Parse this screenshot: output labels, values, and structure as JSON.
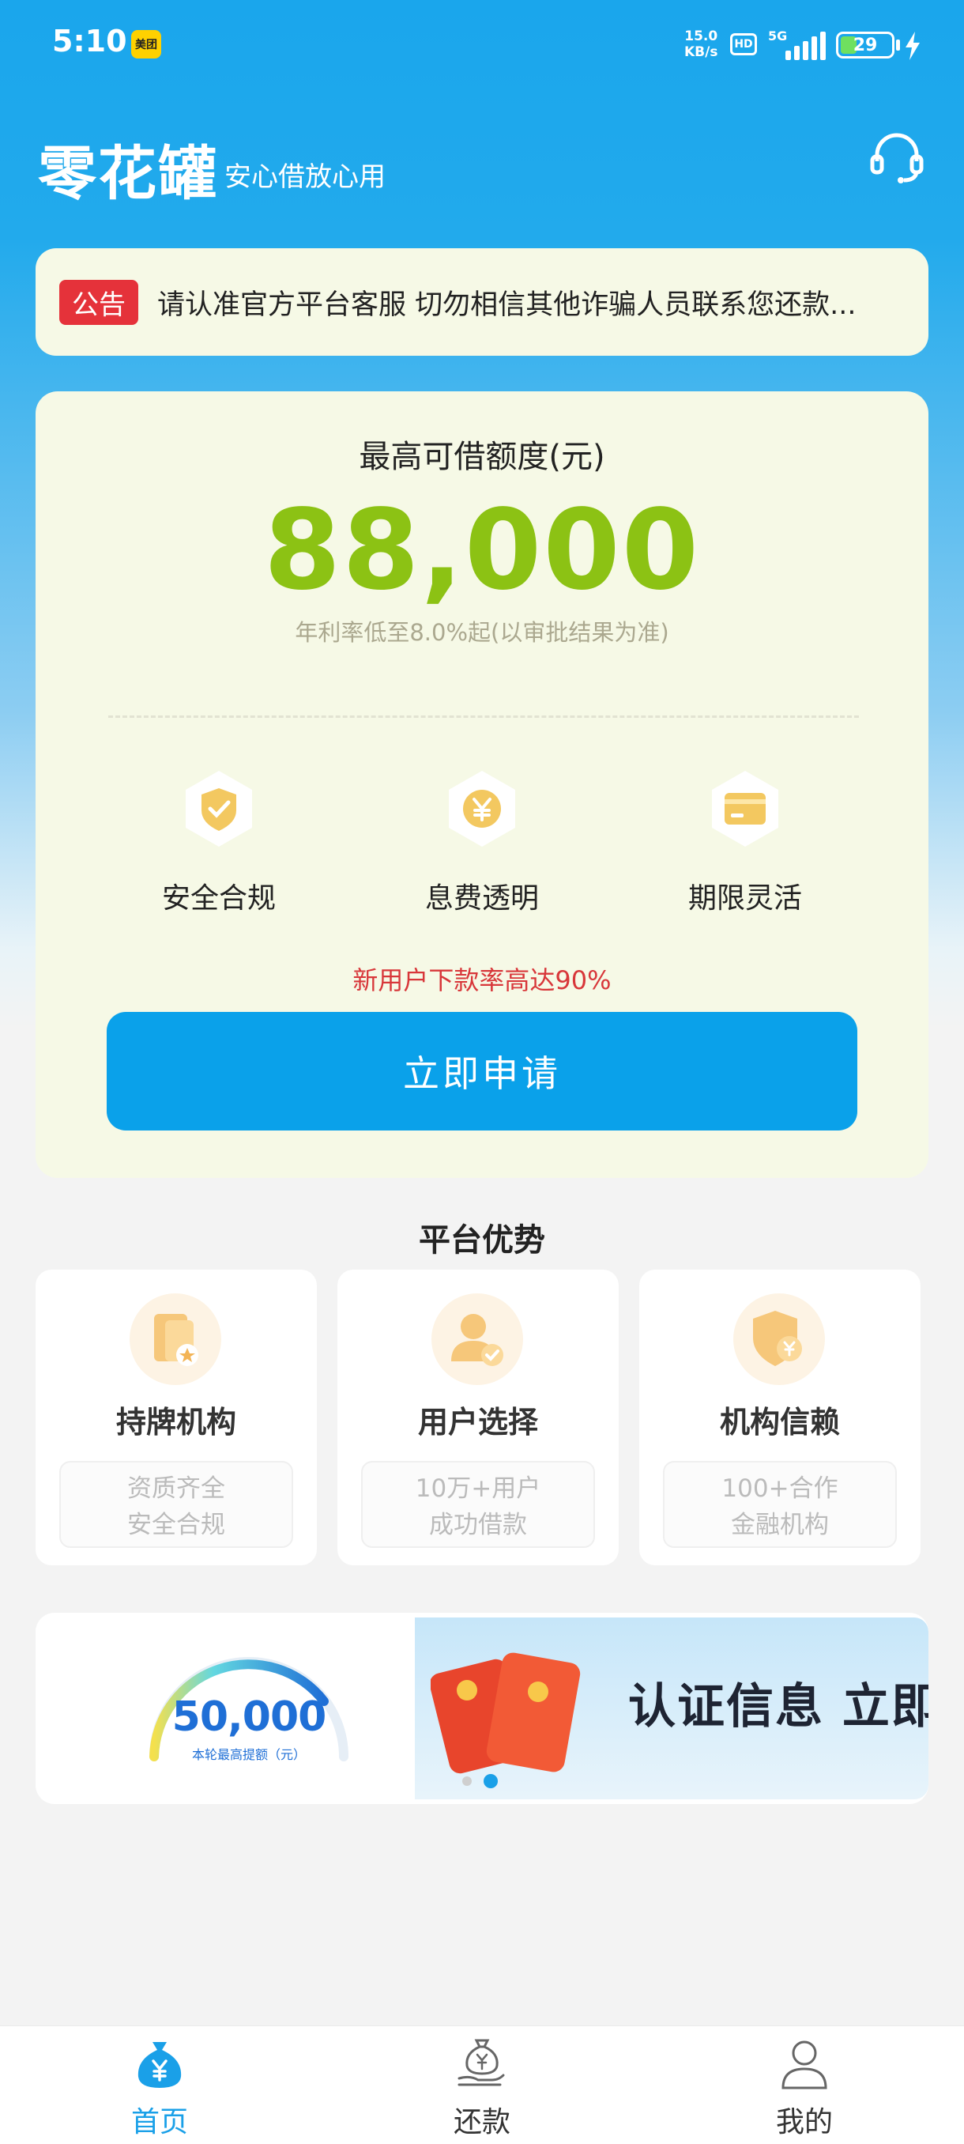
{
  "status_bar": {
    "time": "5:10",
    "app_badge": "美团",
    "net_speed_value": "15.0",
    "net_speed_unit": "KB/s",
    "hd": "HD",
    "network": "5G",
    "battery": "29",
    "battery_level": 0.29
  },
  "header": {
    "title": "零花罐",
    "slogan": "安心借放心用",
    "service_icon": "headset-icon"
  },
  "notice": {
    "tag": "公告",
    "text": "请认准官方平台客服   切勿相信其他诈骗人员联系您还款..."
  },
  "loan_card": {
    "limit_label": "最高可借额度(元)",
    "limit_amount": "88,000",
    "rate_note": "年利率低至8.0%起(以审批结果为准)",
    "features": [
      {
        "label": "安全合规",
        "icon": "shield-check-icon"
      },
      {
        "label": "息费透明",
        "icon": "yen-hexagon-icon"
      },
      {
        "label": "期限灵活",
        "icon": "card-icon"
      }
    ],
    "promo": "新用户下款率高达90%",
    "apply_button": "立即申请"
  },
  "advantages": {
    "title": "平台优势",
    "items": [
      {
        "name": "持牌机构",
        "desc_line1": "资质齐全",
        "desc_line2": "安全合规",
        "icon": "license-icon"
      },
      {
        "name": "用户选择",
        "desc_line1": "10万+用户",
        "desc_line2": "成功借款",
        "icon": "user-check-icon"
      },
      {
        "name": "机构信赖",
        "desc_line1": "100+合作",
        "desc_line2": "金融机构",
        "icon": "shield-yen-icon"
      }
    ]
  },
  "banner": {
    "gauge_value": "50,000",
    "gauge_label": "本轮最高提额（元）",
    "slide2_text": "认证信息  立即",
    "active_slide": 2
  },
  "tab_bar": {
    "tabs": [
      {
        "label": "首页",
        "icon": "money-bag-icon",
        "active": true
      },
      {
        "label": "还款",
        "icon": "repay-hand-icon",
        "active": false
      },
      {
        "label": "我的",
        "icon": "user-icon",
        "active": false
      }
    ]
  },
  "colors": {
    "primary_blue": "#0aa1ea",
    "amount_green": "#8cc214",
    "notice_red": "#e5323a",
    "card_bg": "#f6f9e6"
  }
}
